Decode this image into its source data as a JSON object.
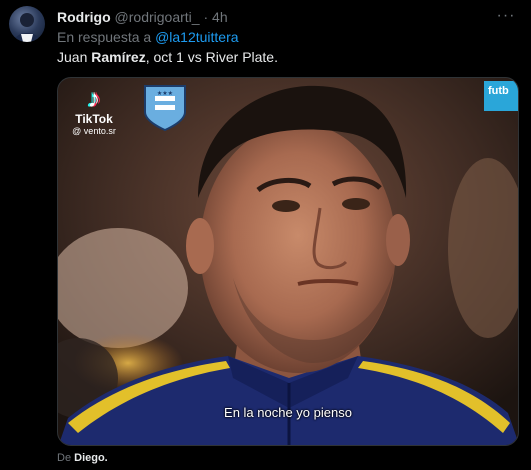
{
  "tweet": {
    "display_name": "Rodrigo",
    "handle": "@rodrigoarti_",
    "separator": "·",
    "time": "4h",
    "more_label": "···",
    "reply_prefix": "En respuesta a",
    "reply_mention": "@la12tuittera",
    "text_part1": "Juan ",
    "text_bold": "Ramírez",
    "text_part2": ", oct 1 vs River Plate."
  },
  "media": {
    "caption": "En la noche yo pienso",
    "tiktok_logo": "♪",
    "tiktok_name": "TikTok",
    "tiktok_user": "@ vento.sr",
    "corner_watermark": "futb",
    "badge_icon": "afa-badge-icon",
    "play_type": "video"
  },
  "footer": {
    "prefix": "De",
    "name": "Diego."
  }
}
